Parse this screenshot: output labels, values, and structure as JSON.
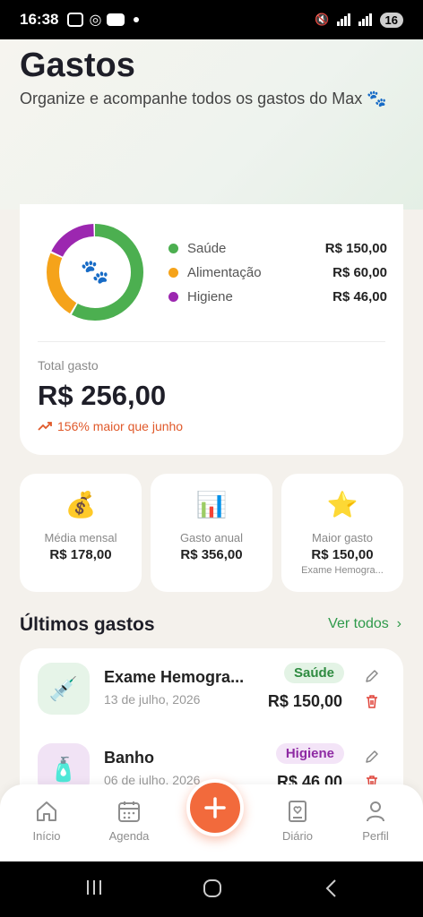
{
  "status_bar": {
    "time": "16:38",
    "battery": "16"
  },
  "header": {
    "title": "Gastos",
    "subtitle": "Organize e acompanhe todos os gastos do Max",
    "subtitle_emoji": "🐾"
  },
  "summary": {
    "donut_center_emoji": "🐾",
    "categories": [
      {
        "label": "Saúde",
        "value": "R$ 150,00",
        "color": "#4caf50",
        "amount": 150
      },
      {
        "label": "Alimentação",
        "value": "R$ 60,00",
        "color": "#f5a31a",
        "amount": 60
      },
      {
        "label": "Higiene",
        "value": "R$ 46,00",
        "color": "#9c27b0",
        "amount": 46
      }
    ],
    "total_label": "Total gasto",
    "total_value": "R$ 256,00",
    "trend_text": "156% maior que junho"
  },
  "stats": [
    {
      "emoji": "💰",
      "label": "Média mensal",
      "value": "R$ 178,00",
      "sub": ""
    },
    {
      "emoji": "📊",
      "label": "Gasto anual",
      "value": "R$ 356,00",
      "sub": ""
    },
    {
      "emoji": "⭐",
      "label": "Maior gasto",
      "value": "R$ 150,00",
      "sub": "Exame Hemogra..."
    }
  ],
  "recent": {
    "title": "Últimos gastos",
    "see_all": "Ver todos",
    "items": [
      {
        "emoji": "💉",
        "name": "Exame Hemogra...",
        "date": "13 de julho, 2026",
        "badge": "Saúde",
        "amount": "R$ 150,00"
      },
      {
        "emoji": "🧴",
        "name": "Banho",
        "date": "06 de julho, 2026",
        "badge": "Higiene",
        "amount": "R$ 46,00"
      }
    ]
  },
  "nav": {
    "items": [
      "Início",
      "Agenda",
      "Diário",
      "Perfil"
    ]
  }
}
